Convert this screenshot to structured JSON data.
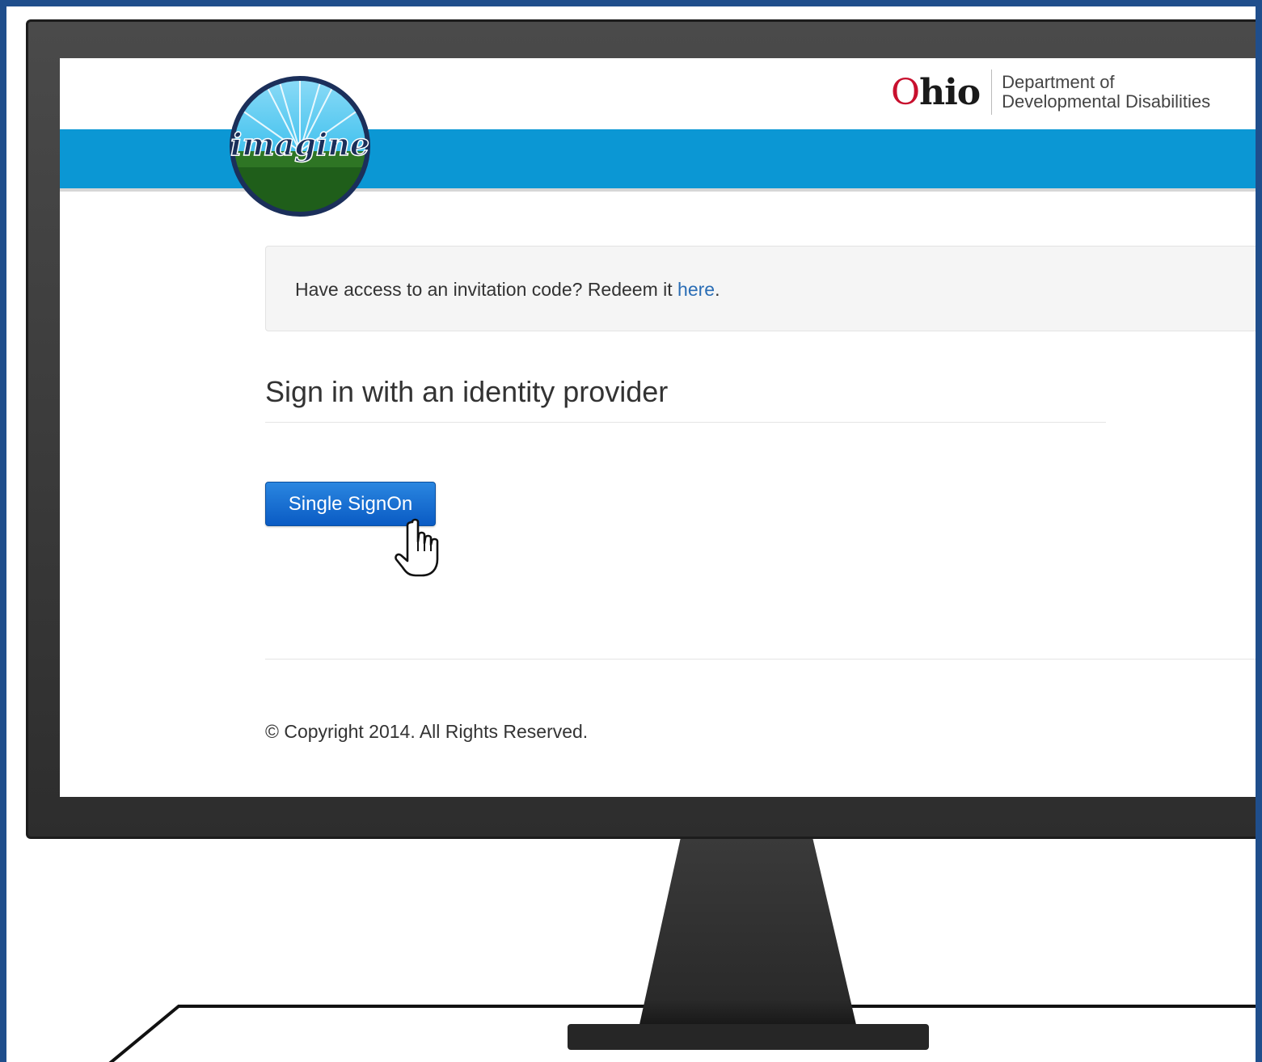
{
  "header": {
    "brand_logo_icon": "imagine-logo",
    "brand_logo_text": "imagine",
    "ohio_logo": {
      "state": "Ohio",
      "department_line1": "Department of",
      "department_line2": "Developmental Disabilities"
    },
    "bar_color": "#0b97d4"
  },
  "notice": {
    "text": "Have access to an invitation code? Redeem it ",
    "link_text": "here",
    "trailing": "."
  },
  "signin": {
    "heading": "Sign in with an identity provider",
    "button_label": "Single SignOn",
    "button_color": "#0a6fd8",
    "cursor_icon": "hand-pointer-icon"
  },
  "footer": {
    "copyright": "© Copyright 2014. All Rights Reserved."
  },
  "frame": {
    "border_color": "#1f4e8c",
    "monitor_color": "#333333"
  }
}
